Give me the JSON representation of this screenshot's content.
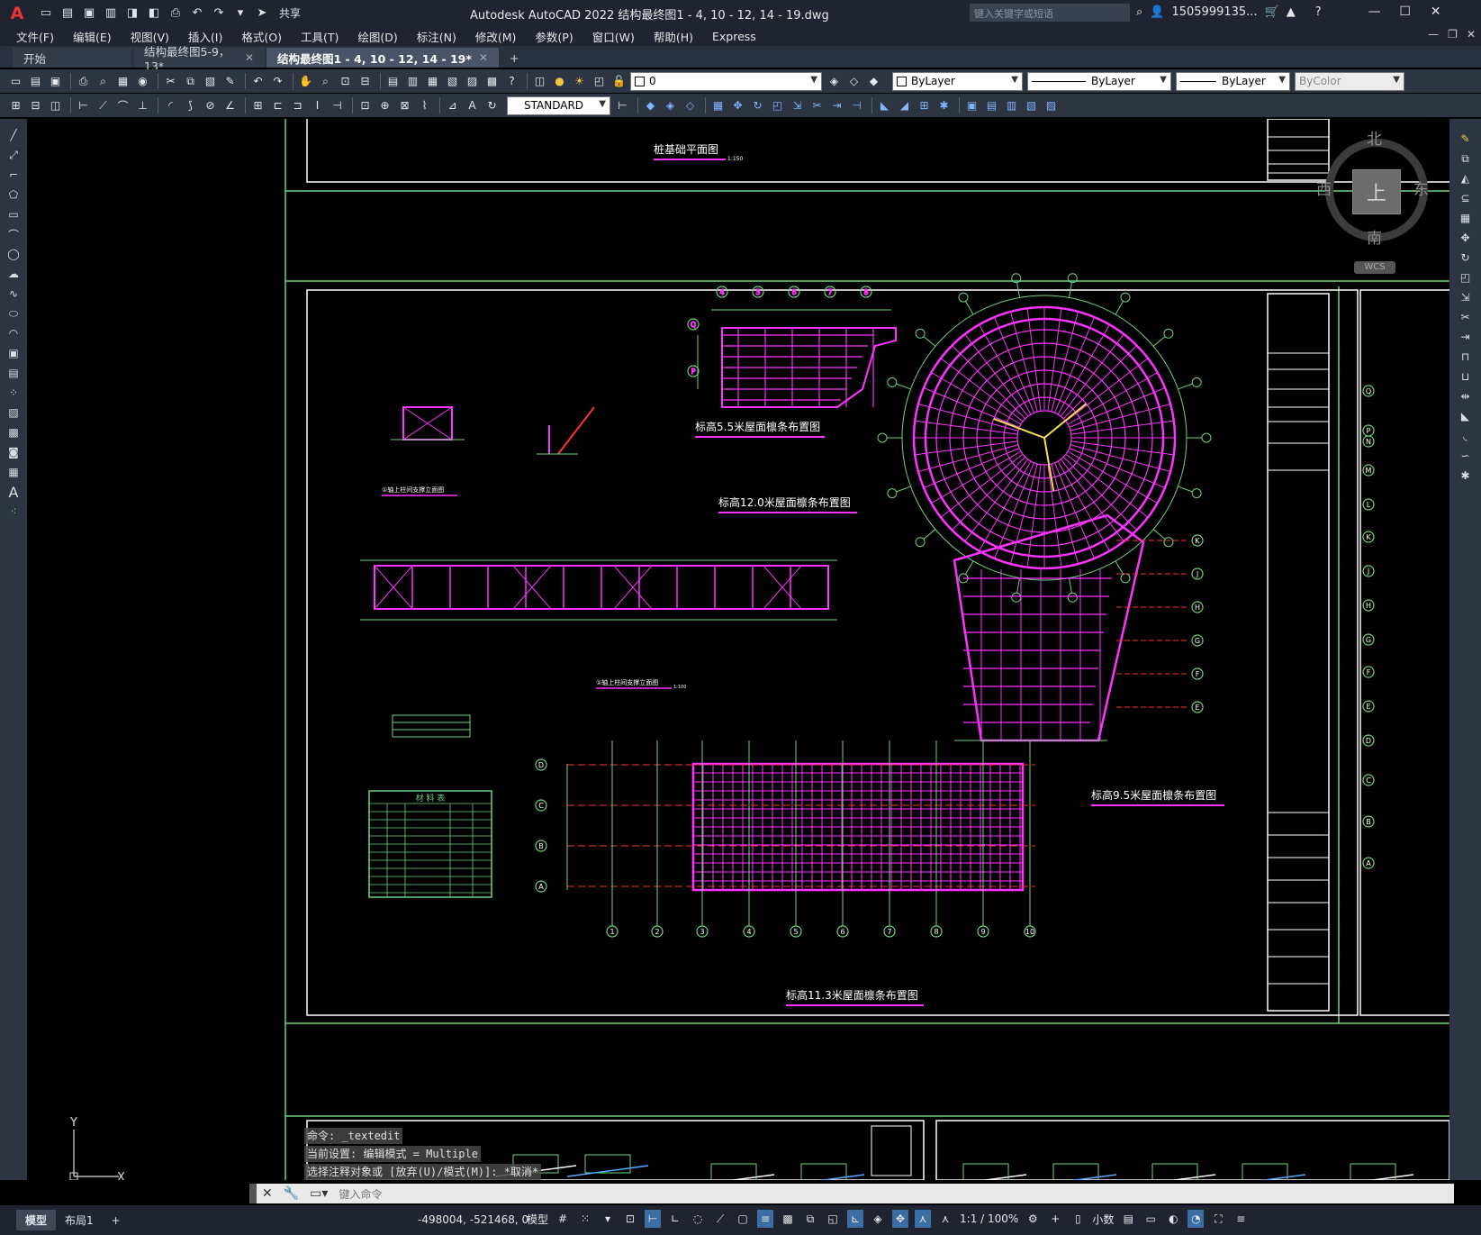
{
  "app": {
    "logo": "A",
    "title": "Autodesk AutoCAD 2022    结构最终图1 - 4,  10 - 12,  14 - 19.dwg",
    "search_placeholder": "键入关键字或短语",
    "user": "1505999135...",
    "share_label": "共享"
  },
  "menu": [
    "文件(F)",
    "编辑(E)",
    "视图(V)",
    "插入(I)",
    "格式(O)",
    "工具(T)",
    "绘图(D)",
    "标注(N)",
    "修改(M)",
    "参数(P)",
    "窗口(W)",
    "帮助(H)",
    "Express"
  ],
  "tabs": [
    {
      "label": "开始"
    },
    {
      "label": "结构最终图5-9，13*"
    },
    {
      "label": "结构最终图1 - 4,  10 - 12,  14 - 19*"
    }
  ],
  "toolbar": {
    "layer_value": "0",
    "color_value": "ByLayer",
    "linetype_value": "ByLayer",
    "lineweight_value": "ByLayer",
    "plotstyle_value": "ByColor",
    "textstyle_value": "STANDARD"
  },
  "viewcube": {
    "north": "北",
    "south": "南",
    "east": "东",
    "west": "西",
    "top": "上",
    "wcs": "WCS"
  },
  "drawing": {
    "titles": {
      "pile": "桩基础平面图",
      "pile_scale": "1:150",
      "roof55": "标高5.5米屋面檩条布置图",
      "roof120": "标高12.0米屋面檩条布置图",
      "roof95": "标高9.5米屋面檩条布置图",
      "roof113": "标高11.3米屋面檩条布置图",
      "brace1": "①轴上柱间支撑立面图",
      "brace2": "①轴上柱间支撑立面图",
      "brace2_scale": "1:100",
      "mat_table": "材 料 表"
    },
    "axis_rows_left": [
      "D",
      "C",
      "B",
      "A"
    ],
    "axis_cols_bottom": [
      "1",
      "2",
      "3",
      "4",
      "5",
      "6",
      "7",
      "8",
      "9",
      "10"
    ],
    "axis_right_edge": [
      "Q",
      "P",
      "N",
      "M",
      "L",
      "K",
      "J",
      "H",
      "G",
      "F",
      "E",
      "D",
      "C",
      "B",
      "A"
    ],
    "axis_95": [
      "K",
      "J",
      "H",
      "G",
      "F",
      "E"
    ],
    "axis_55_top": [
      "4",
      "5",
      "6",
      "7",
      "8"
    ],
    "axis_55_left": [
      "Q",
      "P"
    ]
  },
  "ucs": {
    "y": "Y",
    "x": "X"
  },
  "command": {
    "history": [
      "命令: _textedit",
      "当前设置: 编辑模式 = Multiple",
      "选择注释对象或 [放弃(U)/模式(M)]: *取消*"
    ],
    "placeholder": "键入命令"
  },
  "status": {
    "layout_tabs": [
      "模型",
      "布局1"
    ],
    "coords": "-498004, -521468, 0",
    "model_label": "模型",
    "scale": "1:1 / 100%",
    "units": "小数"
  }
}
